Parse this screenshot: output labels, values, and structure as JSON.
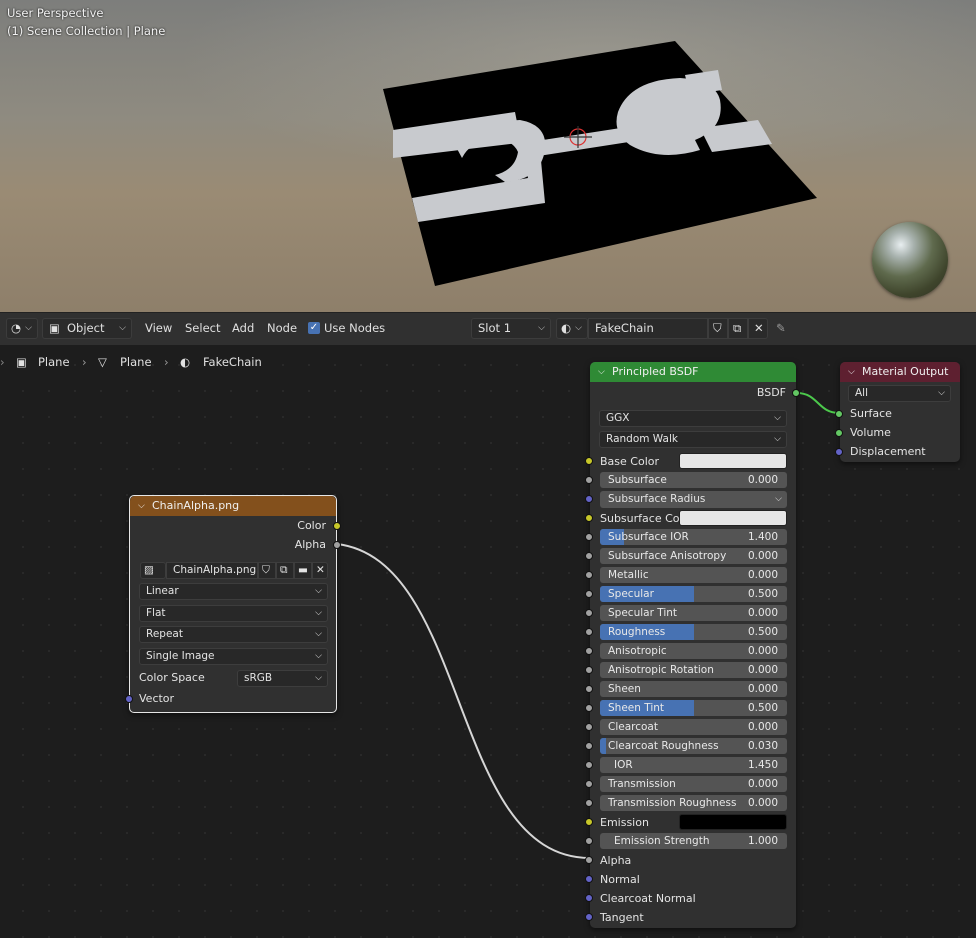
{
  "viewport": {
    "perspective_label": "User Perspective",
    "collection_label": "(1) Scene Collection | Plane"
  },
  "header": {
    "editor_type_icon": "node-editor-icon",
    "mode": "Object",
    "menus": [
      "View",
      "Select",
      "Add",
      "Node"
    ],
    "use_nodes_label": "Use Nodes",
    "use_nodes_checked": true,
    "slot": "Slot 1",
    "material_name": "FakeChain"
  },
  "breadcrumb": [
    "Plane",
    "Plane",
    "FakeChain"
  ],
  "image_node": {
    "title": "ChainAlpha.png",
    "out_color": "Color",
    "out_alpha": "Alpha",
    "image_name": "ChainAlpha.png",
    "interpolation": "Linear",
    "projection": "Flat",
    "extension": "Repeat",
    "source": "Single Image",
    "color_space_label": "Color Space",
    "color_space": "sRGB",
    "in_vector": "Vector",
    "header_color": "#83501c"
  },
  "bsdf_node": {
    "title": "Principled BSDF",
    "output": "BSDF",
    "distribution": "GGX",
    "subsurface_method": "Random Walk",
    "header_color": "#2f8a35",
    "inputs": [
      {
        "label": "Base Color",
        "type": "color",
        "swatch": "#e6e6e6"
      },
      {
        "label": "Subsurface",
        "type": "value",
        "value": "0.000",
        "fill": 0
      },
      {
        "label": "Subsurface Radius",
        "type": "vector"
      },
      {
        "label": "Subsurface Col...",
        "type": "color",
        "swatch": "#e6e6e6"
      },
      {
        "label": "Subsurface IOR",
        "type": "value",
        "value": "1.400",
        "fill": 0.13
      },
      {
        "label": "Subsurface Anisotropy",
        "type": "value",
        "value": "0.000",
        "fill": 0
      },
      {
        "label": "Metallic",
        "type": "value",
        "value": "0.000",
        "fill": 0
      },
      {
        "label": "Specular",
        "type": "value",
        "value": "0.500",
        "fill": 0.5
      },
      {
        "label": "Specular Tint",
        "type": "value",
        "value": "0.000",
        "fill": 0
      },
      {
        "label": "Roughness",
        "type": "value",
        "value": "0.500",
        "fill": 0.5
      },
      {
        "label": "Anisotropic",
        "type": "value",
        "value": "0.000",
        "fill": 0
      },
      {
        "label": "Anisotropic Rotation",
        "type": "value",
        "value": "0.000",
        "fill": 0
      },
      {
        "label": "Sheen",
        "type": "value",
        "value": "0.000",
        "fill": 0
      },
      {
        "label": "Sheen Tint",
        "type": "value",
        "value": "0.500",
        "fill": 0.5
      },
      {
        "label": "Clearcoat",
        "type": "value",
        "value": "0.000",
        "fill": 0
      },
      {
        "label": "Clearcoat Roughness",
        "type": "value",
        "value": "0.030",
        "fill": 0.03
      },
      {
        "label": "IOR",
        "type": "value",
        "value": "1.450",
        "fill": 0
      },
      {
        "label": "Transmission",
        "type": "value",
        "value": "0.000",
        "fill": 0
      },
      {
        "label": "Transmission Roughness",
        "type": "value",
        "value": "0.000",
        "fill": 0
      },
      {
        "label": "Emission",
        "type": "color",
        "swatch": "#000000"
      },
      {
        "label": "Emission Strength",
        "type": "value",
        "value": "1.000",
        "fill": 0
      },
      {
        "label": "Alpha",
        "type": "socket",
        "socket": "gray"
      },
      {
        "label": "Normal",
        "type": "socket",
        "socket": "purple"
      },
      {
        "label": "Clearcoat Normal",
        "type": "socket",
        "socket": "purple"
      },
      {
        "label": "Tangent",
        "type": "socket",
        "socket": "purple"
      }
    ]
  },
  "output_node": {
    "title": "Material Output",
    "target": "All",
    "header_color": "#5e2030",
    "inputs": [
      "Surface",
      "Volume",
      "Displacement"
    ]
  }
}
